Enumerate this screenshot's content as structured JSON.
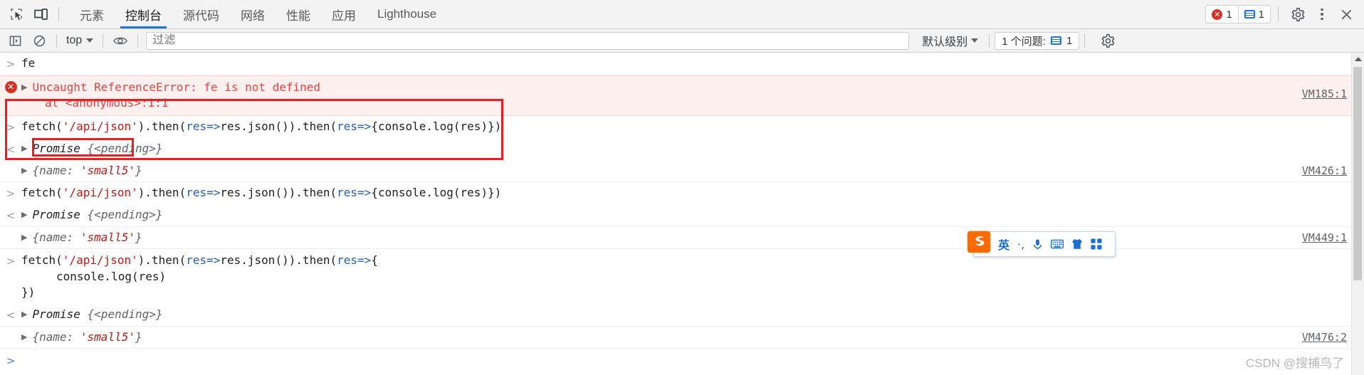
{
  "tabbar": {
    "inspect_icon": "inspect-element-icon",
    "device_icon": "device-toolbar-icon",
    "tabs": [
      {
        "id": "elements",
        "label": "元素",
        "active": false
      },
      {
        "id": "console",
        "label": "控制台",
        "active": true
      },
      {
        "id": "sources",
        "label": "源代码",
        "active": false
      },
      {
        "id": "network",
        "label": "网络",
        "active": false
      },
      {
        "id": "performance",
        "label": "性能",
        "active": false
      },
      {
        "id": "application",
        "label": "应用",
        "active": false
      },
      {
        "id": "lighthouse",
        "label": "Lighthouse",
        "active": false
      }
    ],
    "error_count": "1",
    "message_count": "1",
    "settings_icon": "gear-icon",
    "more_icon": "kebab-menu-icon",
    "close_icon": "close-icon"
  },
  "filterbar": {
    "sidebar_icon": "show-console-sidebar-icon",
    "clear_icon": "clear-console-icon",
    "context_value": "top",
    "eye_icon": "live-expression-icon",
    "filter_placeholder": "过滤",
    "filter_value": "",
    "level_label": "默认级别",
    "issues_label": "1 个问题:",
    "issues_count": "1",
    "settings_icon": "console-settings-gear-icon"
  },
  "console": {
    "rows": [
      {
        "kind": "input",
        "marker": ">",
        "text": "fe"
      },
      {
        "kind": "error",
        "marker": "error",
        "text": "Uncaught ReferenceError: fe is not defined",
        "stack": "at <anonymous>:1:1",
        "vmlink": "VM185:1"
      },
      {
        "kind": "input",
        "marker": ">",
        "code_tokens": [
          {
            "t": "plain",
            "v": "fetch("
          },
          {
            "t": "str",
            "v": "'/api/json'"
          },
          {
            "t": "plain",
            "v": ").then("
          },
          {
            "t": "param",
            "v": "res=>"
          },
          {
            "t": "plain",
            "v": "res.json()).then("
          },
          {
            "t": "param",
            "v": "res=>"
          },
          {
            "t": "plain",
            "v": "{console.log(res)})"
          }
        ],
        "text": "fetch('/api/json').then(res=>res.json()).then(res=>{console.log(res)})"
      },
      {
        "kind": "result",
        "marker": "<",
        "text": "Promise {<pending>}",
        "obj_name": "Promise",
        "obj_val": "{<pending>}"
      },
      {
        "kind": "object",
        "marker": "",
        "text": "{name: 'small5'}",
        "key": "{name: ",
        "value": "'small5'",
        "tail": "}",
        "vmlink": "VM426:1",
        "boxed": true
      },
      {
        "kind": "input",
        "marker": ">",
        "text": "fetch('/api/json').then(res=>res.json()).then(res=>{console.log(res)})"
      },
      {
        "kind": "result",
        "marker": "<",
        "text": "Promise {<pending>}",
        "obj_name": "Promise",
        "obj_val": "{<pending>}"
      },
      {
        "kind": "object",
        "marker": "",
        "text": "{name: 'small5'}",
        "key": "{name: ",
        "value": "'small5'",
        "tail": "}",
        "vmlink": "VM449:1"
      },
      {
        "kind": "input-multiline",
        "marker": ">",
        "line1": "fetch('/api/json').then(res=>res.json()).then(res=>{",
        "line2": "console.log(res)",
        "line3": "})"
      },
      {
        "kind": "result",
        "marker": "<",
        "text": "Promise {<pending>}",
        "obj_name": "Promise",
        "obj_val": "{<pending>}"
      },
      {
        "kind": "object",
        "marker": "",
        "text": "{name: 'small5'}",
        "key": "{name: ",
        "value": "'small5'",
        "tail": "}",
        "vmlink": "VM476:2"
      },
      {
        "kind": "prompt",
        "marker": ">",
        "text": ""
      }
    ]
  },
  "ime": {
    "logo": "sogou-pinyin-logo",
    "items": [
      {
        "name": "language-mode",
        "glyph": "英"
      },
      {
        "name": "punctuation-mode",
        "glyph": "·,"
      },
      {
        "name": "voice-input-icon",
        "glyph": "🎤"
      },
      {
        "name": "soft-keyboard-icon",
        "glyph": "⌨"
      },
      {
        "name": "skin-icon",
        "glyph": "👕"
      },
      {
        "name": "toolbox-icon",
        "glyph": "⬛"
      }
    ]
  },
  "watermark": {
    "text": "CSDN @搜捕鸟了"
  },
  "colors": {
    "accent": "#1a73e8",
    "error": "#d93025",
    "error_text": "#ef4040",
    "annotation": "#ee1c1c",
    "string": "#c41a16",
    "param": "#2a5db0"
  }
}
